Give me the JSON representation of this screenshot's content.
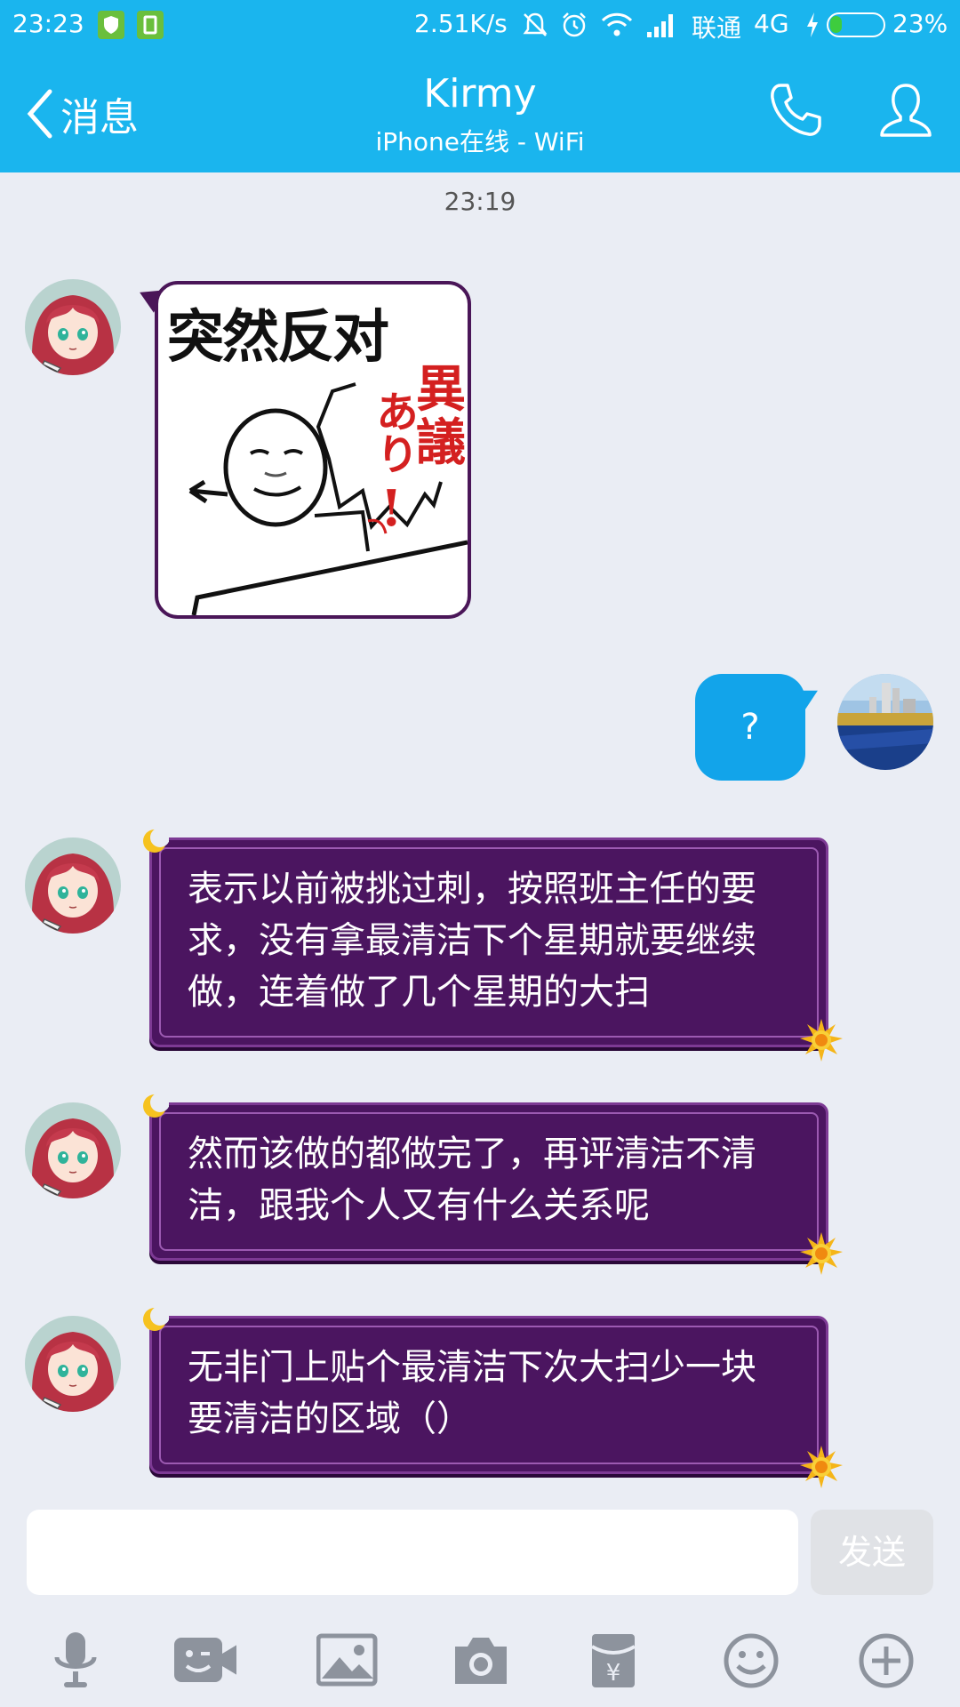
{
  "status_bar": {
    "time": "23:23",
    "network_speed": "2.51K/s",
    "carrier": "联通",
    "network_type": "4G",
    "battery_percent": "23%",
    "battery_level": 0.23,
    "icons": [
      "shield-icon",
      "sim-icon",
      "mute-icon",
      "alarm-icon",
      "wifi-icon",
      "signal-icon",
      "charging-icon",
      "battery-icon"
    ]
  },
  "header": {
    "back_label": "消息",
    "contact_name": "Kirmy",
    "contact_status": "iPhone在线 - WiFi",
    "icons": [
      "back-chevron-icon",
      "phone-icon",
      "profile-icon"
    ]
  },
  "chat": {
    "timestamp": "23:19",
    "sticker": {
      "caption": "突然反对",
      "side_text_1": "異",
      "side_text_2": "議",
      "side_text_3": "あり",
      "side_text_4": "!"
    },
    "outgoing_message": "?",
    "incoming_messages": [
      "表示以前被挑过刺，按照班主任的要求，没有拿最清洁下个星期就要继续做，连着做了几个星期的大扫",
      "然而该做的都做完了，再评清洁不清洁，跟我个人又有什么关系呢",
      "无非门上贴个最清洁下次大扫少一块要清洁的区域（）"
    ]
  },
  "input": {
    "value": "",
    "send_label": "发送"
  },
  "toolbar": {
    "icons": [
      "microphone-icon",
      "video-icon",
      "image-icon",
      "camera-icon",
      "red-packet-icon",
      "emoji-icon",
      "plus-icon"
    ]
  },
  "colors": {
    "header_bg": "#1ab5ee",
    "chat_bg": "#eaedf4",
    "outgoing_bubble": "#12a4ea",
    "incoming_bubble": "#4b1560"
  }
}
